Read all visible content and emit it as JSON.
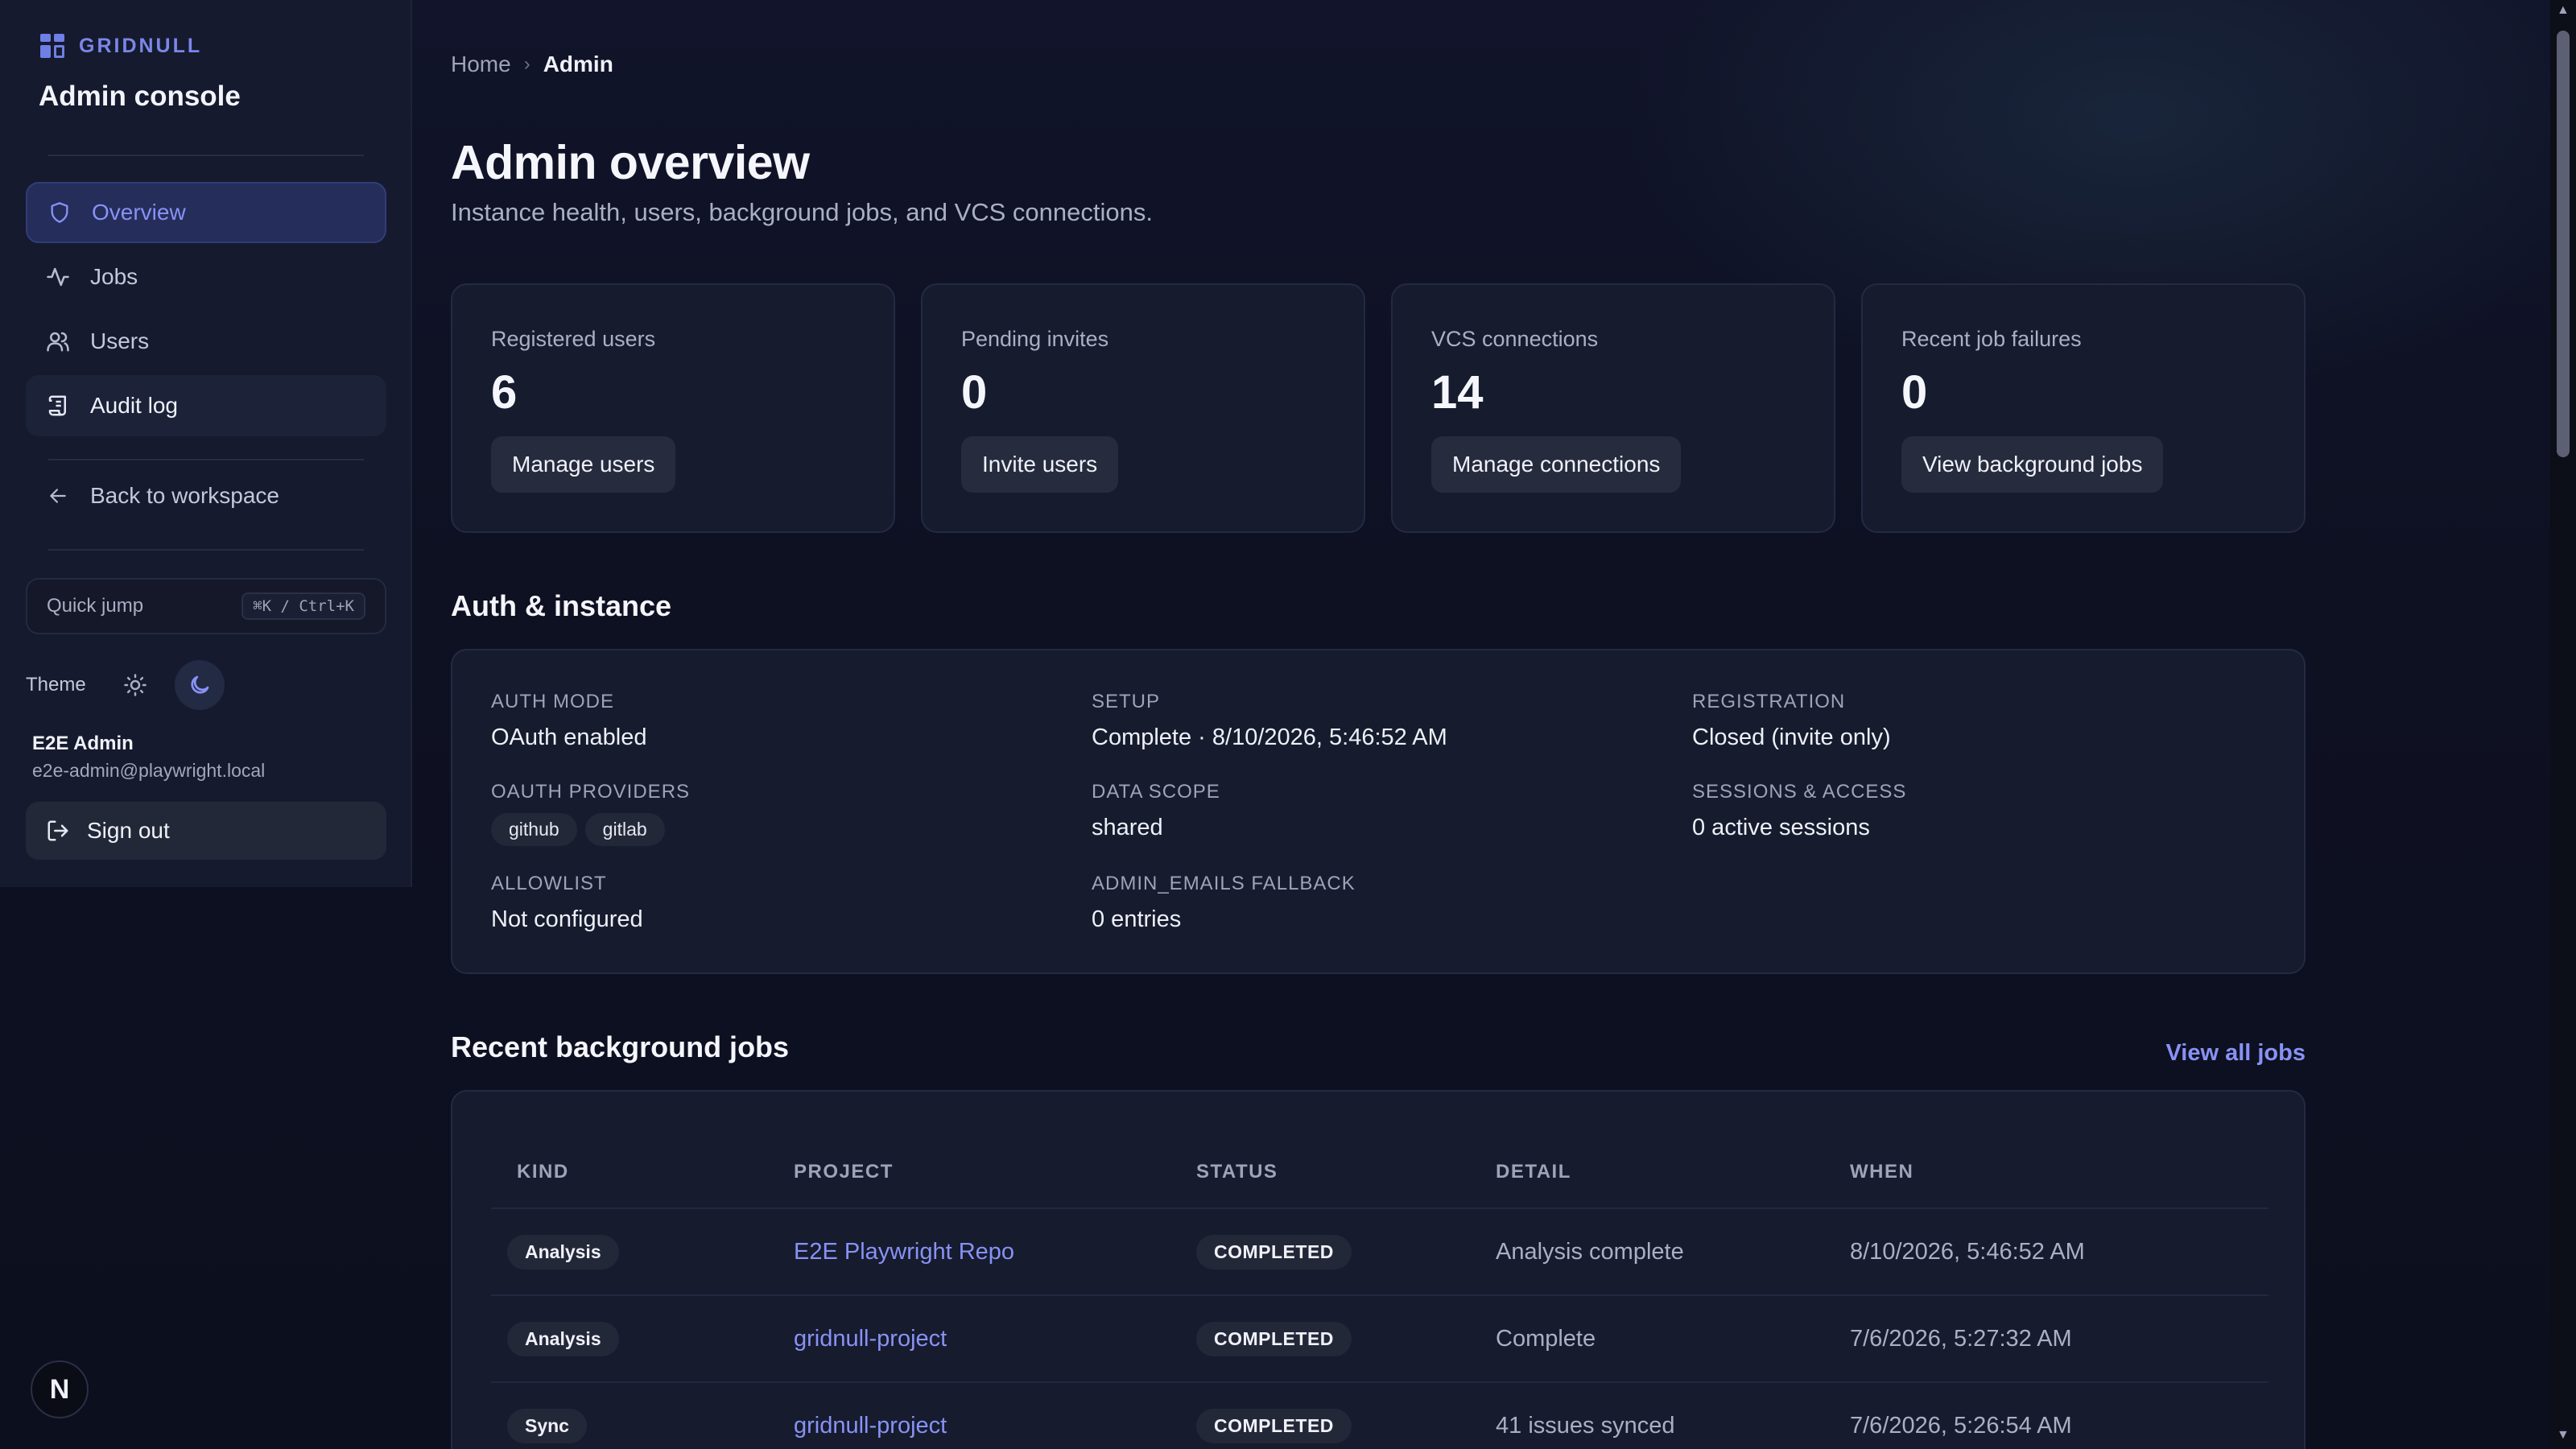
{
  "sidebar": {
    "brand": "GRIDNULL",
    "title": "Admin console",
    "nav": [
      {
        "label": "Overview",
        "icon": "shield-icon"
      },
      {
        "label": "Jobs",
        "icon": "activity-icon"
      },
      {
        "label": "Users",
        "icon": "users-icon"
      },
      {
        "label": "Audit log",
        "icon": "scroll-icon"
      }
    ],
    "back_label": "Back to workspace",
    "quick_jump": {
      "label": "Quick jump",
      "shortcut": "⌘K / Ctrl+K"
    },
    "theme_label": "Theme",
    "user": {
      "name": "E2E Admin",
      "email": "e2e-admin@playwright.local"
    },
    "sign_out": "Sign out",
    "badge": "N"
  },
  "breadcrumb": {
    "home": "Home",
    "current": "Admin"
  },
  "page": {
    "title": "Admin overview",
    "subtitle": "Instance health, users, background jobs, and VCS connections."
  },
  "stats": [
    {
      "label": "Registered users",
      "value": "6",
      "action": "Manage users"
    },
    {
      "label": "Pending invites",
      "value": "0",
      "action": "Invite users"
    },
    {
      "label": "VCS connections",
      "value": "14",
      "action": "Manage connections"
    },
    {
      "label": "Recent job failures",
      "value": "0",
      "action": "View background jobs"
    }
  ],
  "auth": {
    "title": "Auth & instance",
    "auth_mode": {
      "key": "AUTH MODE",
      "value": "OAuth enabled"
    },
    "setup": {
      "key": "SETUP",
      "value": "Complete · 8/10/2026, 5:46:52 AM"
    },
    "registration": {
      "key": "REGISTRATION",
      "value": "Closed (invite only)"
    },
    "oauth_providers": {
      "key": "OAUTH PROVIDERS",
      "values": [
        "github",
        "gitlab"
      ]
    },
    "data_scope": {
      "key": "DATA SCOPE",
      "value": "shared"
    },
    "sessions": {
      "key": "SESSIONS & ACCESS",
      "value": "0 active sessions"
    },
    "allowlist": {
      "key": "ALLOWLIST",
      "value": "Not configured"
    },
    "admin_emails": {
      "key": "ADMIN_EMAILS FALLBACK",
      "value": "0 entries"
    }
  },
  "jobs": {
    "title": "Recent background jobs",
    "view_all": "View all jobs",
    "columns": [
      "KIND",
      "PROJECT",
      "STATUS",
      "DETAIL",
      "WHEN"
    ],
    "rows": [
      {
        "kind": "Analysis",
        "project": "E2E Playwright Repo",
        "status": "COMPLETED",
        "detail": "Analysis complete",
        "when": "8/10/2026, 5:46:52 AM"
      },
      {
        "kind": "Analysis",
        "project": "gridnull-project",
        "status": "COMPLETED",
        "detail": "Complete",
        "when": "7/6/2026, 5:27:32 AM"
      },
      {
        "kind": "Sync",
        "project": "gridnull-project",
        "status": "COMPLETED",
        "detail": "41 issues synced",
        "when": "7/6/2026, 5:26:54 AM"
      }
    ]
  },
  "colors": {
    "accent": "#8892f4",
    "background": "#0d1020",
    "card": "#161b2e"
  }
}
